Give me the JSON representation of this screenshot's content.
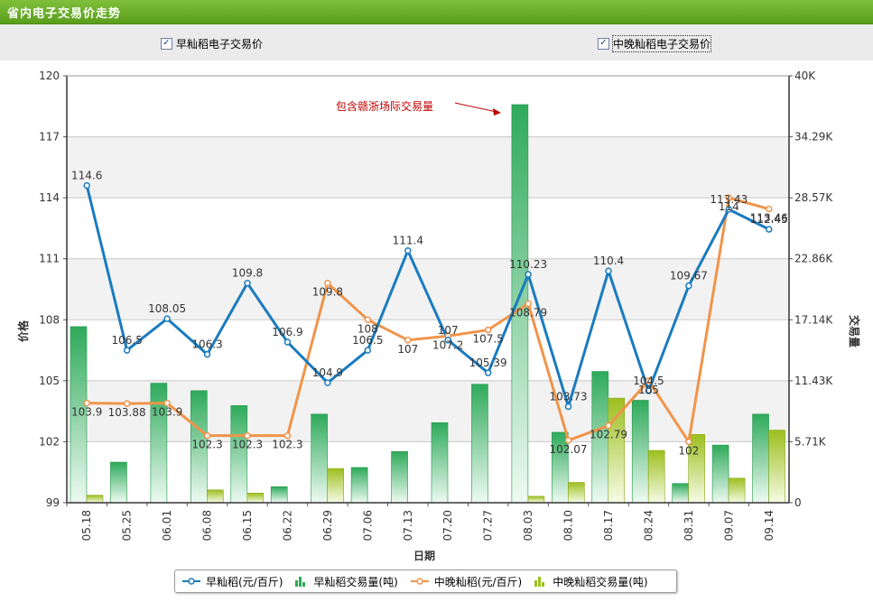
{
  "header": {
    "title": "省内电子交易价走势"
  },
  "checkboxes": [
    {
      "label": "早籼稻电子交易价",
      "checked": "✓"
    },
    {
      "label": "中晚籼稻电子交易价",
      "checked": "✓"
    }
  ],
  "annotation": {
    "text": "包含赣浙场际交易量"
  },
  "legend": [
    {
      "label": "早籼稻(元/百斤)"
    },
    {
      "label": "早籼稻交易量(吨)"
    },
    {
      "label": "中晚籼稻(元/百斤)"
    },
    {
      "label": "中晚籼稻交易量(吨)"
    }
  ],
  "colors": {
    "early_line": "#1a7bbf",
    "late_line": "#f0944a",
    "early_bar": "#2eaa5a",
    "late_bar": "#9cbf1e"
  },
  "chart_data": {
    "type": "bar+line",
    "categories": [
      "05.18",
      "05.25",
      "06.01",
      "06.08",
      "06.15",
      "06.22",
      "06.29",
      "07.06",
      "07.13",
      "07.20",
      "07.27",
      "08.03",
      "08.10",
      "08.17",
      "08.24",
      "08.31",
      "09.07",
      "09.14"
    ],
    "xlabel": "日期",
    "ylabel": "价格",
    "y2label": "交易量",
    "ylim": [
      99,
      120
    ],
    "yticks": [
      "99",
      "102",
      "105",
      "108",
      "111",
      "114",
      "117",
      "120"
    ],
    "y2lim": [
      0,
      40000
    ],
    "y2ticks": [
      "0",
      "5.71K",
      "11.43K",
      "17.14K",
      "22.86K",
      "28.57K",
      "34.29K",
      "40K"
    ],
    "grid": true,
    "series": [
      {
        "name": "早籼稻(元/百斤)",
        "kind": "line",
        "values": [
          114.6,
          106.5,
          108.05,
          106.3,
          109.8,
          106.9,
          104.9,
          106.5,
          111.4,
          107,
          105.39,
          110.23,
          103.73,
          110.4,
          104.5,
          109.67,
          113.43,
          112.45
        ],
        "labels": [
          "114.6",
          "106.5",
          "108.05",
          "106.3",
          "109.8",
          "106.9",
          "104.9",
          "106.5",
          "111.4",
          "107",
          "105.39",
          "110.23",
          "103.73",
          "110.4",
          "104.5",
          "109.67",
          "113.43",
          "112.45"
        ]
      },
      {
        "name": "中晚籼稻(元/百斤)",
        "kind": "line",
        "values": [
          103.9,
          103.88,
          103.9,
          102.3,
          102.3,
          102.3,
          109.8,
          108,
          107,
          107.2,
          107.5,
          108.79,
          102.07,
          102.79,
          105,
          102,
          114,
          113.45
        ],
        "labels": [
          "103.9",
          "103.88",
          "103.9",
          "102.3",
          "102.3",
          "102.3",
          "109.8",
          "108",
          "107",
          "107.2",
          "107.5",
          "108.79",
          "102.07",
          "102.79",
          "105",
          "102",
          "114",
          "113.46"
        ]
      },
      {
        "name": "早籼稻交易量(吨)",
        "kind": "bar",
        "values": [
          16500,
          3800,
          11200,
          10500,
          9100,
          1500,
          8300,
          3300,
          4800,
          7500,
          11100,
          37300,
          6600,
          12300,
          9600,
          1800,
          5400,
          8300
        ]
      },
      {
        "name": "中晚籼稻交易量(吨)",
        "kind": "bar",
        "values": [
          700,
          0,
          0,
          1200,
          900,
          0,
          3200,
          0,
          0,
          0,
          0,
          600,
          1900,
          9800,
          4900,
          6400,
          2300,
          6800
        ]
      }
    ]
  }
}
